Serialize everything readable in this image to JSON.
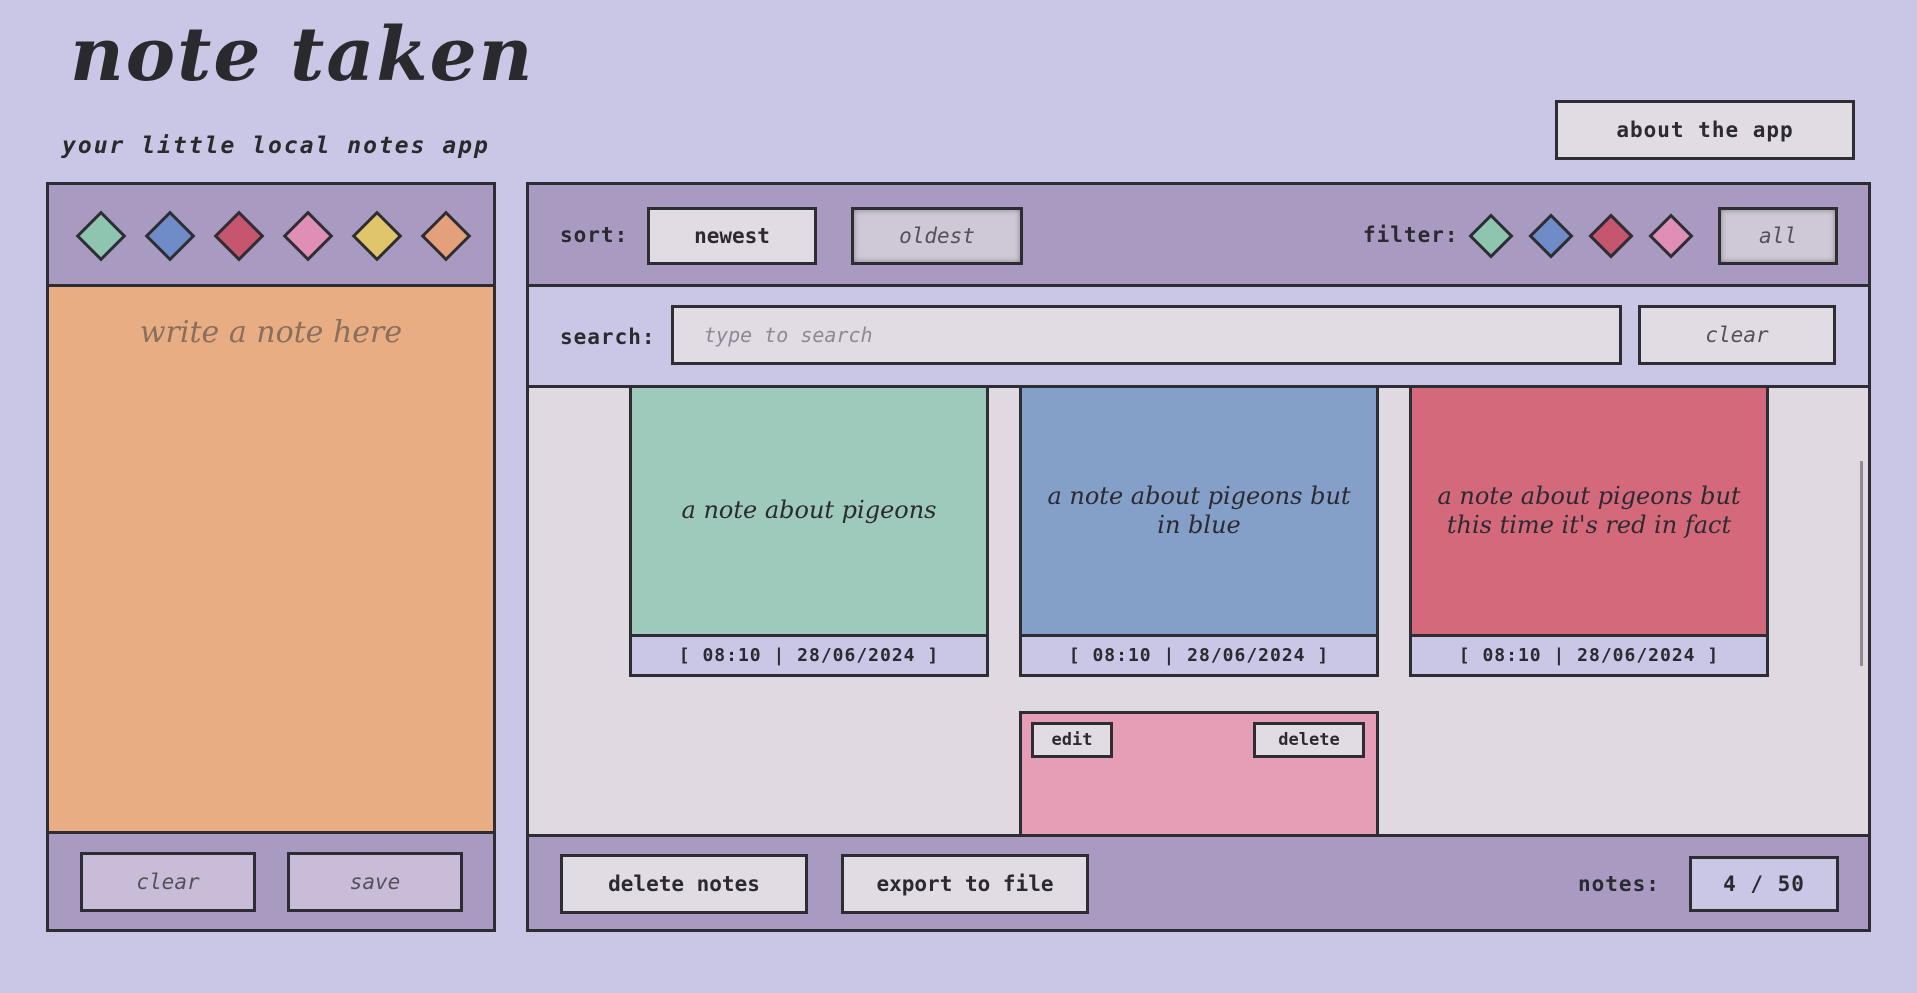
{
  "header": {
    "title": "note taken",
    "subtitle": "your little local notes app",
    "about_label": "about the app"
  },
  "editor": {
    "colors": [
      {
        "name": "teal",
        "hex": "#8dc5b0"
      },
      {
        "name": "blue",
        "hex": "#6f8cc8"
      },
      {
        "name": "red",
        "hex": "#c65670"
      },
      {
        "name": "pink",
        "hex": "#df8fb5"
      },
      {
        "name": "yellow",
        "hex": "#e0c56a"
      },
      {
        "name": "orange",
        "hex": "#e4a07a"
      }
    ],
    "placeholder": "write a note here",
    "note_color": "#e9ad84",
    "clear_label": "clear",
    "save_label": "save"
  },
  "toolbar": {
    "sort_label": "sort:",
    "sort_newest": "newest",
    "sort_oldest": "oldest",
    "filter_label": "filter:",
    "filter_colors": [
      "#8dc5b0",
      "#6f8cc8",
      "#c65670",
      "#df8fb5"
    ],
    "filter_all": "all"
  },
  "search": {
    "label": "search:",
    "placeholder": "type to search",
    "value": "",
    "clear_label": "clear"
  },
  "notes": [
    {
      "text": "a note about pigeons",
      "date": "[ 08:10 | 28/06/2024 ]",
      "color": "#9dcabb"
    },
    {
      "text": "a note about pigeons but in blue",
      "date": "[ 08:10 | 28/06/2024 ]",
      "color": "#849fc8"
    },
    {
      "text": "a note about pigeons but this time it's red in fact",
      "date": "[ 08:10 | 28/06/2024 ]",
      "color": "#d4697c"
    },
    {
      "text": "",
      "date": "",
      "color": "#e59eb5",
      "edit_label": "edit",
      "delete_label": "delete"
    }
  ],
  "footer": {
    "delete_label": "delete notes",
    "export_label": "export to file",
    "count_label": "notes:",
    "count_value": "4 / 50"
  }
}
